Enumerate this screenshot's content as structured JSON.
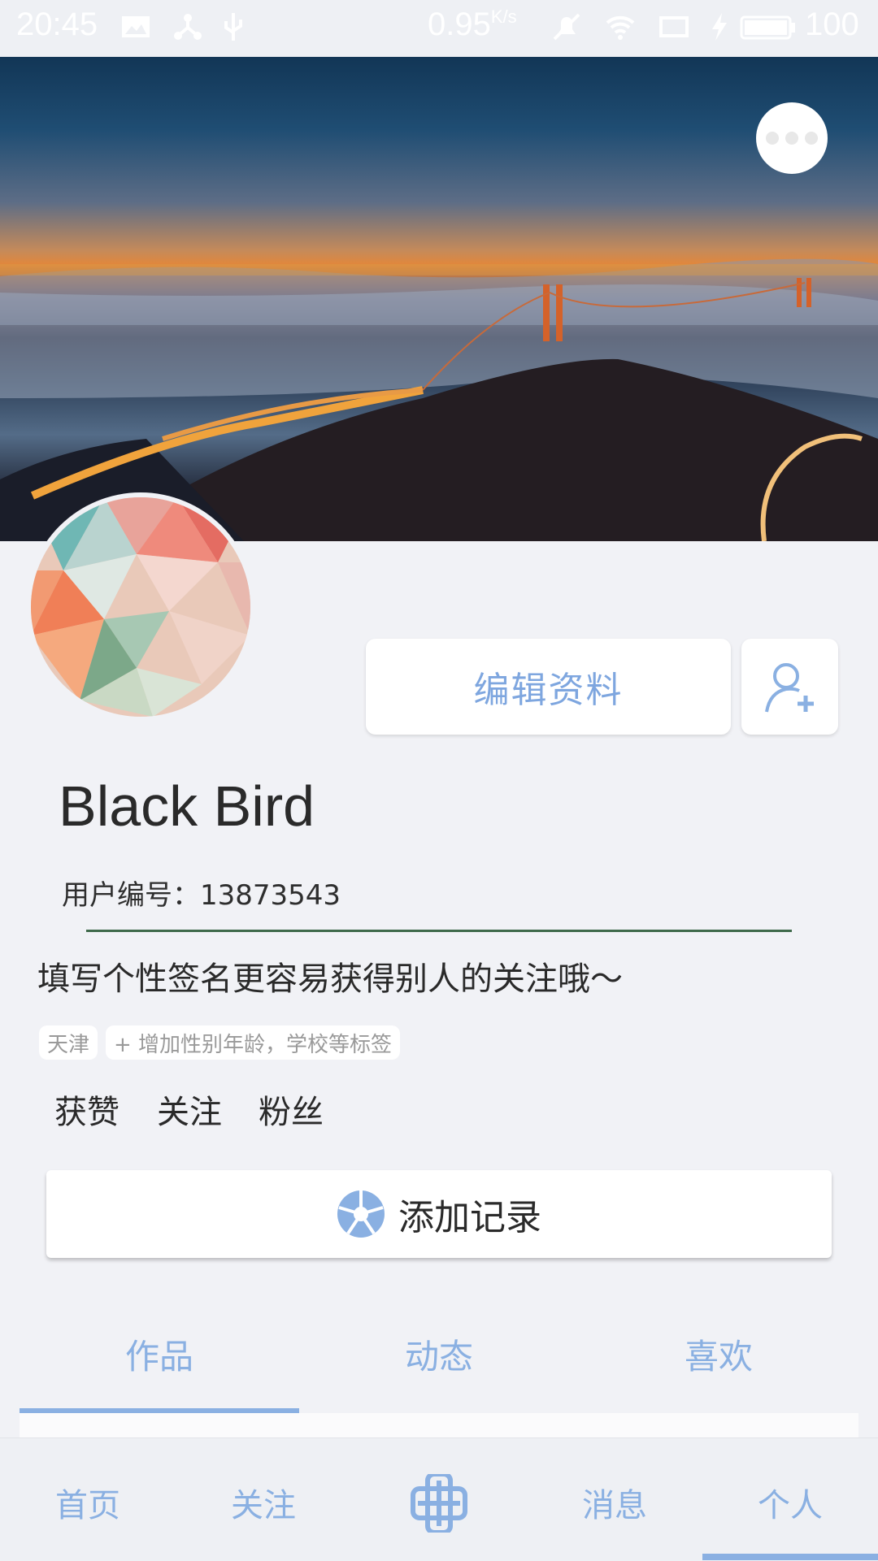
{
  "status_bar": {
    "time": "20:45",
    "net_speed": "0.95",
    "net_unit": "K/s",
    "battery": "100"
  },
  "profile": {
    "name": "Black Bird",
    "user_id_label": "用户编号：",
    "user_id": "13873543",
    "signature": "填写个性签名更容易获得别人的关注哦～",
    "edit_button": "编辑资料",
    "tags": [
      "天津",
      "+ 增加性别年龄，学校等标签"
    ],
    "stats": [
      "获赞",
      "关注",
      "粉丝"
    ],
    "add_record": "添加记录"
  },
  "tabs": [
    "作品",
    "动态",
    "喜欢"
  ],
  "bottom_nav": [
    "首页",
    "关注",
    "消息",
    "个人"
  ],
  "colors": {
    "accent": "#8ab0e2",
    "text": "#2a2a2a",
    "background": "#f1f2f6"
  }
}
